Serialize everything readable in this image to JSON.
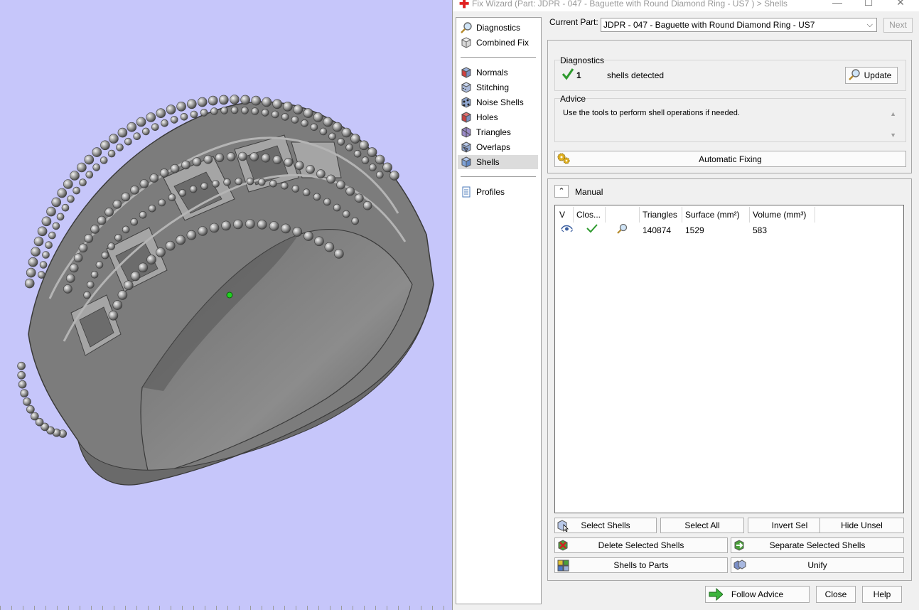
{
  "window": {
    "title": "Fix Wizard (Part: JDPR - 047 - Baguette with Round Diamond  Ring - US7 ) > Shells",
    "controls": {
      "minimize": "—",
      "maximize": "☐",
      "close": "✕"
    }
  },
  "nav": {
    "group1": [
      {
        "label": "Diagnostics",
        "icon": "magnifier-icon"
      },
      {
        "label": "Combined Fix",
        "icon": "cube-icon"
      }
    ],
    "group2": [
      {
        "label": "Normals",
        "icon": "normals-cube-icon"
      },
      {
        "label": "Stitching",
        "icon": "stitching-cube-icon"
      },
      {
        "label": "Noise Shells",
        "icon": "noise-shells-icon"
      },
      {
        "label": "Holes",
        "icon": "holes-cube-icon"
      },
      {
        "label": "Triangles",
        "icon": "triangles-cube-icon"
      },
      {
        "label": "Overlaps",
        "icon": "overlaps-cube-icon"
      },
      {
        "label": "Shells",
        "icon": "shells-cube-icon",
        "active": true
      }
    ],
    "group3": [
      {
        "label": "Profiles",
        "icon": "document-icon"
      }
    ]
  },
  "current_part": {
    "label": "Current Part:",
    "value": "JDPR - 047 - Baguette with Round Diamond  Ring - US7",
    "next_label": "Next"
  },
  "diagnostics": {
    "title": "Diagnostics",
    "count": "1",
    "text": "shells detected",
    "update_label": "Update"
  },
  "advice": {
    "title": "Advice",
    "text": "Use the tools to perform shell operations if needed."
  },
  "automatic_fixing_label": "Automatic Fixing",
  "manual": {
    "title": "Manual",
    "columns": [
      "V",
      "Clos...",
      "",
      "Triangles",
      "Surface (mm²)",
      "Volume (mm³)"
    ],
    "rows": [
      {
        "triangles": "140874",
        "surface": "1529",
        "volume": "583"
      }
    ]
  },
  "buttons": {
    "select_shells": "Select Shells",
    "select_all": "Select All",
    "invert_sel": "Invert Sel",
    "hide_unsel": "Hide Unsel",
    "delete_selected_shells": "Delete Selected Shells",
    "separate_selected_shells": "Separate Selected Shells",
    "shells_to_parts": "Shells to Parts",
    "unify": "Unify",
    "follow_advice": "Follow Advice",
    "close": "Close",
    "help": "Help"
  },
  "colors": {
    "viewport_background": "#c6c6fa",
    "ring_metal": "#8a8a8a",
    "check_green": "#2e9a2e",
    "title_text_gray": "#9a9a9a"
  }
}
